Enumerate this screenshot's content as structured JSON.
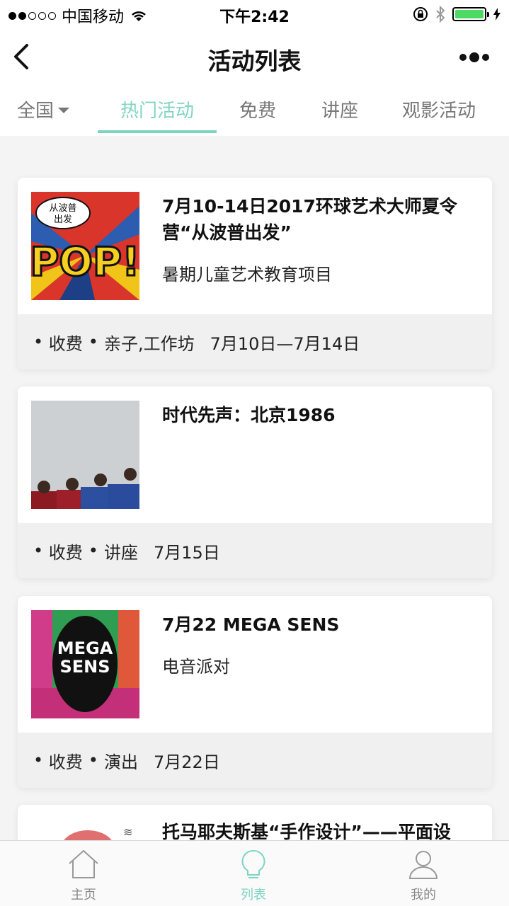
{
  "status_bar": {
    "carrier": "中国移动",
    "time": "下午2:42",
    "battery_color": "#4cd964"
  },
  "nav": {
    "title": "活动列表",
    "back_icon": "chevron-left-icon",
    "more_icon": "more-dots-icon"
  },
  "tabs": {
    "region": "全国",
    "items": [
      "热门活动",
      "免费",
      "讲座",
      "观影活动"
    ],
    "active_index": 0,
    "accent_color": "#7fd4c1"
  },
  "events": [
    {
      "title": "7月10-14日2017环球艺术大师夏令营“从波普出发”",
      "subtitle": "暑期儿童艺术教育项目",
      "fee": "收费",
      "tags": "亲子,工作坊",
      "date": "7月10日—7月14日",
      "thumb_text": "从波普出发",
      "thumb_big_text": "POP!"
    },
    {
      "title": "时代先声：北京1986",
      "subtitle": "",
      "fee": "收费",
      "tags": "讲座",
      "date": "7月15日"
    },
    {
      "title": "7月22 MEGA SENS",
      "subtitle": "电音派对",
      "fee": "收费",
      "tags": "演出",
      "date": "7月22日",
      "thumb_text": "MEGA SENS"
    },
    {
      "title": "托马耶夫斯基“手作设计”——平面设"
    }
  ],
  "tabbar": {
    "items": [
      {
        "label": "主页",
        "icon": "home-icon"
      },
      {
        "label": "列表",
        "icon": "lightbulb-icon"
      },
      {
        "label": "我的",
        "icon": "user-icon"
      }
    ],
    "active_index": 1
  }
}
